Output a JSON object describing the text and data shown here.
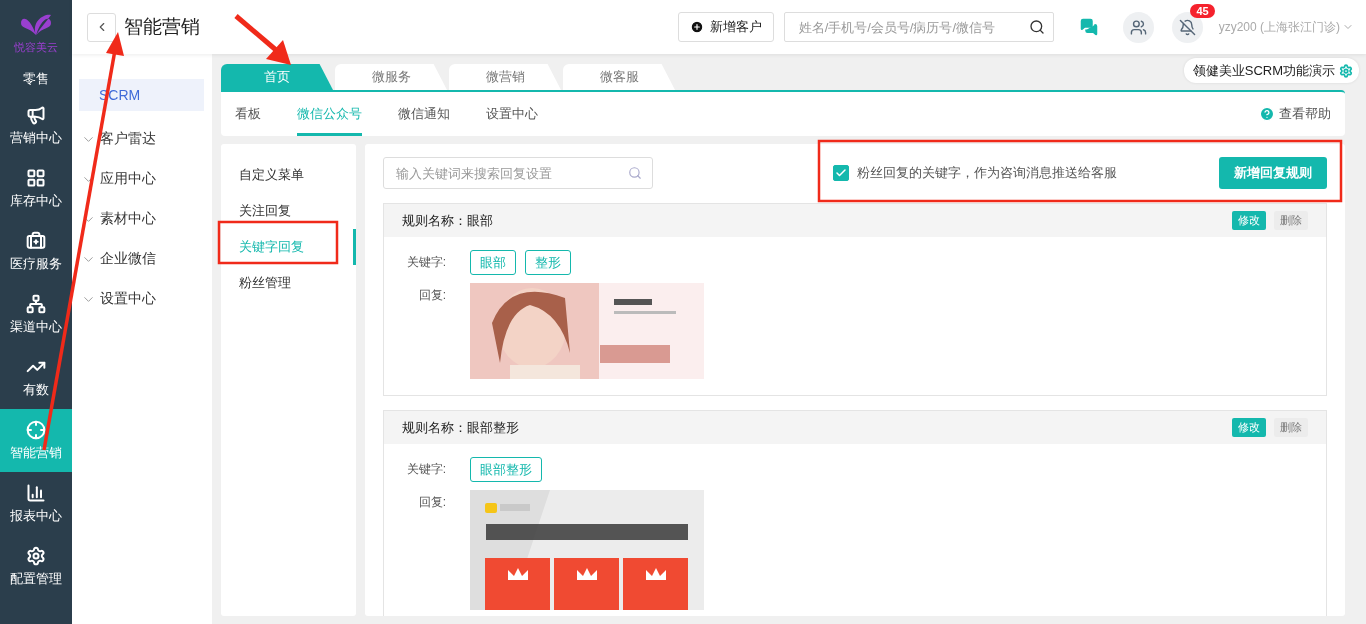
{
  "brand": {
    "name": "悦容美云"
  },
  "nav": [
    {
      "label": "零售",
      "selected": false
    },
    {
      "label": "营销中心",
      "selected": false
    },
    {
      "label": "库存中心",
      "selected": false
    },
    {
      "label": "医疗服务",
      "selected": false
    },
    {
      "label": "渠道中心",
      "selected": false
    },
    {
      "label": "有数",
      "selected": false
    },
    {
      "label": "智能营销",
      "selected": true
    },
    {
      "label": "报表中心",
      "selected": false
    },
    {
      "label": "配置管理",
      "selected": false
    }
  ],
  "header": {
    "title": "智能营销",
    "add_button": "新增客户",
    "search": {
      "placeholder": "姓名/手机号/会员号/病历号/微信号"
    },
    "notification_count": "45",
    "user": "yzy200 (上海张江门诊)"
  },
  "sidebar": {
    "items": [
      {
        "label": "SCRM",
        "selected": true,
        "expandable": false
      },
      {
        "label": "客户雷达",
        "selected": false,
        "expandable": true
      },
      {
        "label": "应用中心",
        "selected": false,
        "expandable": true
      },
      {
        "label": "素材中心",
        "selected": false,
        "expandable": true
      },
      {
        "label": "企业微信",
        "selected": false,
        "expandable": true
      },
      {
        "label": "设置中心",
        "selected": false,
        "expandable": true
      }
    ]
  },
  "tabs": [
    {
      "label": "首页",
      "selected": true
    },
    {
      "label": "微服务",
      "selected": false
    },
    {
      "label": "微营销",
      "selected": false
    },
    {
      "label": "微客服",
      "selected": false
    }
  ],
  "demo_tag": "领健美业SCRM功能演示",
  "subtabs": [
    {
      "label": "看板",
      "selected": false
    },
    {
      "label": "微信公众号",
      "selected": true
    },
    {
      "label": "微信通知",
      "selected": false
    },
    {
      "label": "设置中心",
      "selected": false
    }
  ],
  "help": "查看帮助",
  "menu": [
    {
      "label": "自定义菜单",
      "selected": false
    },
    {
      "label": "关注回复",
      "selected": false
    },
    {
      "label": "关键字回复",
      "selected": true
    },
    {
      "label": "粉丝管理",
      "selected": false
    }
  ],
  "rule_search": {
    "placeholder": "输入关键词来搜索回复设置"
  },
  "forward_option": {
    "label": "粉丝回复的关键字，作为咨询消息推送给客服",
    "checked": true
  },
  "new_rule_button": "新增回复规则",
  "rules": [
    {
      "title": "规则名称：眼部",
      "keywords_label": "关键字:",
      "keywords": [
        "眼部",
        "整形"
      ],
      "reply_label": "回复:",
      "reply": {
        "kind": "picture"
      },
      "edit": "修改",
      "delete": "删除"
    },
    {
      "title": "规则名称：眼部整形",
      "keywords_label": "关键字:",
      "keywords": [
        "眼部整形"
      ],
      "reply_label": "回复:",
      "reply": {
        "kind": "picture"
      },
      "edit": "修改",
      "delete": "删除"
    }
  ]
}
